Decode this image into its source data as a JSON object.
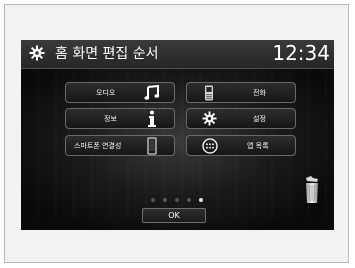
{
  "header": {
    "title": "홈 화면 편집 순서",
    "time": "12:34",
    "icon": "gear-icon"
  },
  "tiles": {
    "audio": {
      "label": "오디오",
      "icon": "music-note-icon"
    },
    "info": {
      "label": "정보",
      "icon": "info-icon"
    },
    "phone_link": {
      "label": "스마트폰 연결성",
      "icon": "smartphone-icon"
    },
    "phone": {
      "label": "전화",
      "icon": "phone-icon"
    },
    "settings": {
      "label": "설정",
      "icon": "gear-icon"
    },
    "app_list": {
      "label": "앱 목록",
      "icon": "app-grid-icon"
    }
  },
  "pagination": {
    "pages": 5,
    "active_page": 5
  },
  "ok_button": {
    "label": "OK"
  },
  "trash": {
    "icon": "trash-icon"
  }
}
